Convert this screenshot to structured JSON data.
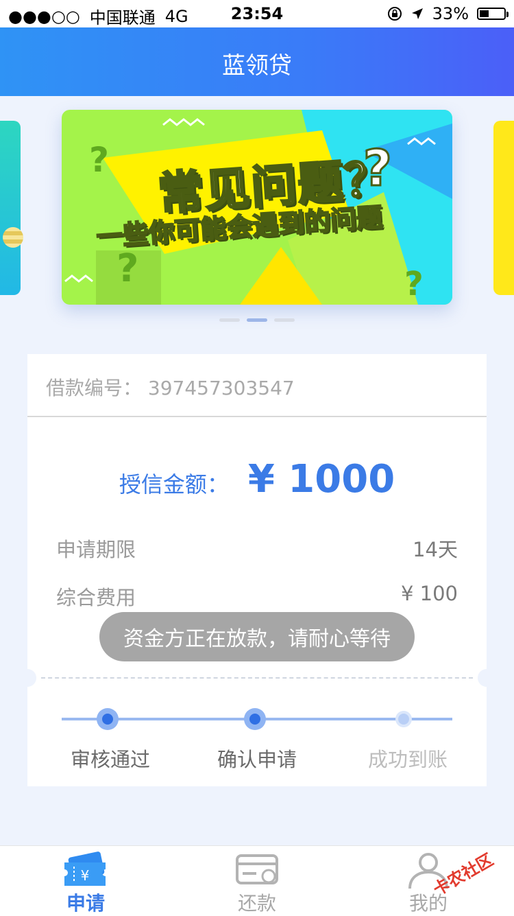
{
  "status_bar": {
    "signal": "●●●○○",
    "carrier": "中国联通",
    "network": "4G",
    "time": "23:54",
    "battery": "33%",
    "battery_level": 0.33
  },
  "header": {
    "title": "蓝领贷"
  },
  "banner": {
    "title": "常见问题？",
    "subtitle": "一些你可能会遇到的问题",
    "page_count": 3,
    "active_index": 1
  },
  "loan": {
    "number_label": "借款编号：",
    "number": "397457303547",
    "credit_label": "授信金额：",
    "credit_amount": "¥ 1000",
    "term_label": "申请期限",
    "term_value": "14天",
    "fee_label": "综合费用",
    "fee_value": "¥ 100"
  },
  "toast": "资金方正在放款，请耐心等待",
  "progress": {
    "steps": [
      {
        "label": "审核通过",
        "state": "done"
      },
      {
        "label": "确认申请",
        "state": "done"
      },
      {
        "label": "成功到账",
        "state": "pending"
      }
    ]
  },
  "tabs": [
    {
      "label": "申请",
      "icon": "ticket-yen-icon",
      "active": true
    },
    {
      "label": "还款",
      "icon": "card-coin-icon",
      "active": false
    },
    {
      "label": "我的",
      "icon": "user-icon",
      "active": false
    }
  ],
  "colors": {
    "accent": "#3b7be6",
    "header_start": "#2f93f5",
    "header_end": "#4b5ff8"
  },
  "watermark": "卡农社区"
}
